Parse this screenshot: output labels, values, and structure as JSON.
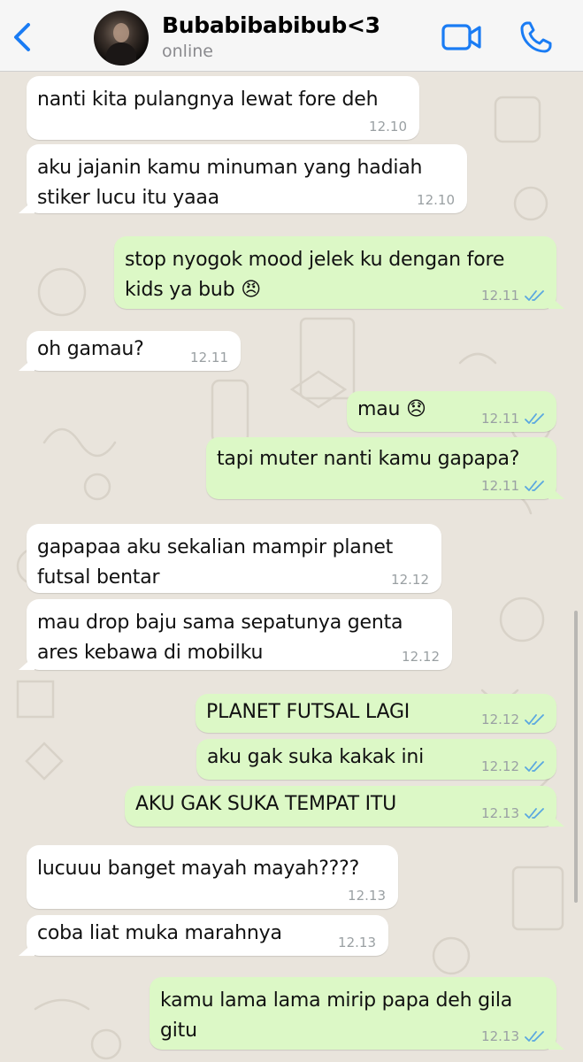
{
  "header": {
    "contact_name": "Bubabibabibub<3",
    "status": "online"
  },
  "colors": {
    "accent": "#1a7cf4",
    "incoming_bubble": "#ffffff",
    "outgoing_bubble": "#dcf8c6",
    "read_tick": "#5aa7e0",
    "wallpaper": "#e9e4dc"
  },
  "icons": {
    "back": "chevron-left-icon",
    "video": "video-call-icon",
    "phone": "phone-icon",
    "read_receipt": "double-check-icon"
  },
  "messages": [
    {
      "dir": "in",
      "text": "nanti kita pulangnya lewat fore deh",
      "time": "12.10"
    },
    {
      "dir": "in",
      "text": "aku jajanin kamu minuman yang hadiah\nstiker lucu itu yaaa",
      "time": "12.10"
    },
    {
      "dir": "out",
      "text": "stop nyogok mood jelek ku dengan fore\nkids ya bub 😠",
      "time": "12.11",
      "read": true
    },
    {
      "dir": "in",
      "text": "oh gamau?",
      "time": "12.11"
    },
    {
      "dir": "out",
      "text": "mau 😞",
      "time": "12.11",
      "read": true
    },
    {
      "dir": "out",
      "text": "tapi muter nanti kamu gapapa?",
      "time": "12.11",
      "read": true
    },
    {
      "dir": "in",
      "text": "gapapaa aku sekalian mampir planet\nfutsal bentar",
      "time": "12.12"
    },
    {
      "dir": "in",
      "text": "mau drop baju sama sepatunya genta\nares kebawa di mobilku",
      "time": "12.12"
    },
    {
      "dir": "out",
      "text": "PLANET FUTSAL LAGI",
      "time": "12.12",
      "read": true
    },
    {
      "dir": "out",
      "text": "aku gak suka kakak ini",
      "time": "12.12",
      "read": true
    },
    {
      "dir": "out",
      "text": "AKU GAK SUKA TEMPAT ITU",
      "time": "12.13",
      "read": true
    },
    {
      "dir": "in",
      "text": "lucuuu banget mayah mayah????",
      "time": "12.13"
    },
    {
      "dir": "in",
      "text": "coba liat muka marahnya",
      "time": "12.13"
    },
    {
      "dir": "out",
      "text": "kamu lama lama mirip papa deh gila\ngitu",
      "time": "12.13",
      "read": true
    }
  ]
}
